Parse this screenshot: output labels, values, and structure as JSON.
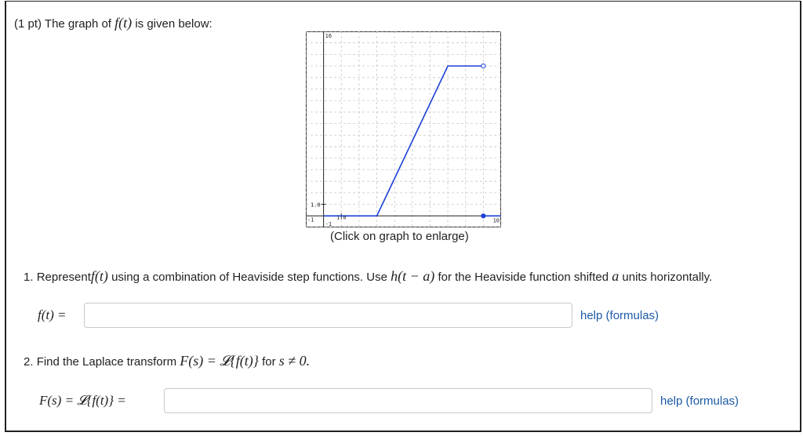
{
  "intro": {
    "prefix": "(1 pt) The graph of",
    "func": "f(t)",
    "suffix": "is given below:"
  },
  "graph": {
    "caption": "(Click on graph to enlarge)",
    "tick_labels": {
      "ymax": "16",
      "ymark": "1.0",
      "ymin": "-1",
      "xmin": "-1",
      "xmark": "1.0",
      "xmax": "10"
    }
  },
  "chart_data": {
    "type": "line",
    "xlim": [
      -1,
      10
    ],
    "ylim": [
      -1,
      16
    ],
    "grid": true,
    "series": [
      {
        "x": [
          0,
          3,
          7,
          9
        ],
        "y": [
          0,
          0,
          13,
          13
        ],
        "endpoints": "open circle at (9,13)"
      },
      {
        "x": [
          9,
          11
        ],
        "y": [
          0,
          0
        ],
        "endpoints": "filled circle at (9,0)"
      }
    ]
  },
  "q1": {
    "number": "1.",
    "text_a": "Represent",
    "func": "f(t)",
    "text_b": "using a combination of Heaviside step functions. Use",
    "heav": "h(t − a)",
    "text_c": "for the Heaviside function shifted",
    "a": "a",
    "text_d": "units horizontally.",
    "lhs": "f(t) =",
    "input_value": "",
    "help": "help (formulas)"
  },
  "q2": {
    "number": "2.",
    "text_a": "Find the Laplace transform",
    "expr": "F(s) = 𝓛{f(t)}",
    "text_b": "for",
    "cond": "s ≠ 0.",
    "lhs": "F(s) = 𝓛{f(t)} =",
    "input_value": "",
    "help": "help (formulas)"
  }
}
